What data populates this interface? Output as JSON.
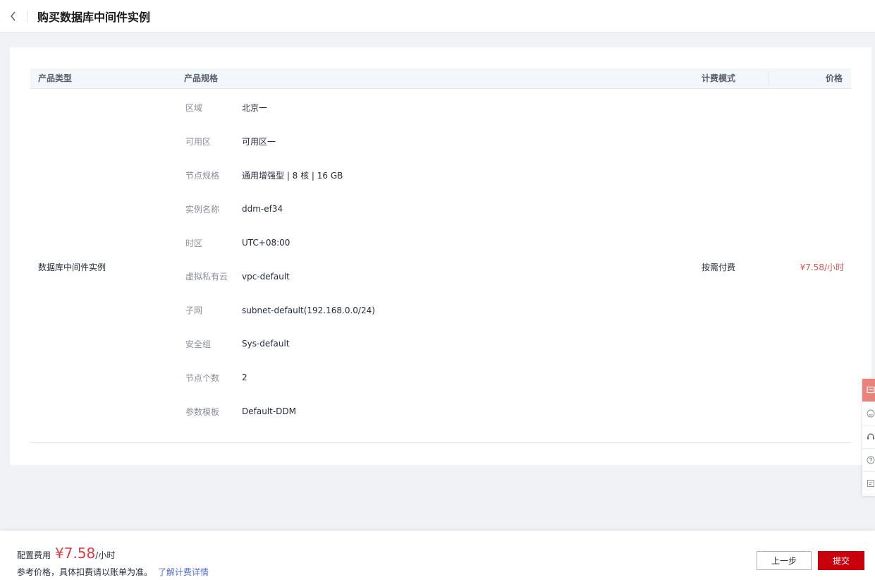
{
  "header": {
    "title": "购买数据库中间件实例"
  },
  "table": {
    "headers": {
      "type": "产品类型",
      "spec": "产品规格",
      "billing": "计费模式",
      "price": "价格"
    },
    "product_type": "数据库中间件实例",
    "billing_mode": "按需付费",
    "price": "¥7.58/小时",
    "specs": [
      {
        "label": "区域",
        "value": "北京一"
      },
      {
        "label": "可用区",
        "value": "可用区一"
      },
      {
        "label": "节点规格",
        "value": "通用增强型 | 8 核 | 16 GB"
      },
      {
        "label": "实例名称",
        "value": "ddm-ef34"
      },
      {
        "label": "时区",
        "value": "UTC+08:00"
      },
      {
        "label": "虚拟私有云",
        "value": "vpc-default"
      },
      {
        "label": "子网",
        "value": "subnet-default(192.168.0.0/24)"
      },
      {
        "label": "安全组",
        "value": "Sys-default"
      },
      {
        "label": "节点个数",
        "value": "2"
      },
      {
        "label": "参数模板",
        "value": "Default-DDM"
      }
    ]
  },
  "footer": {
    "fee_label": "配置费用",
    "fee_amount": "¥7.58",
    "fee_unit": "/小时",
    "note": "参考价格，具体扣费请以账单为准。",
    "link": "了解计费详情",
    "prev_label": "上一步",
    "submit_label": "提交"
  },
  "side_tools": [
    "feedback-icon",
    "smile-icon",
    "headset-icon",
    "help-icon",
    "document-icon"
  ],
  "colors": {
    "accent": "#c7000b",
    "price": "#e4393c",
    "link": "#526ecc"
  }
}
